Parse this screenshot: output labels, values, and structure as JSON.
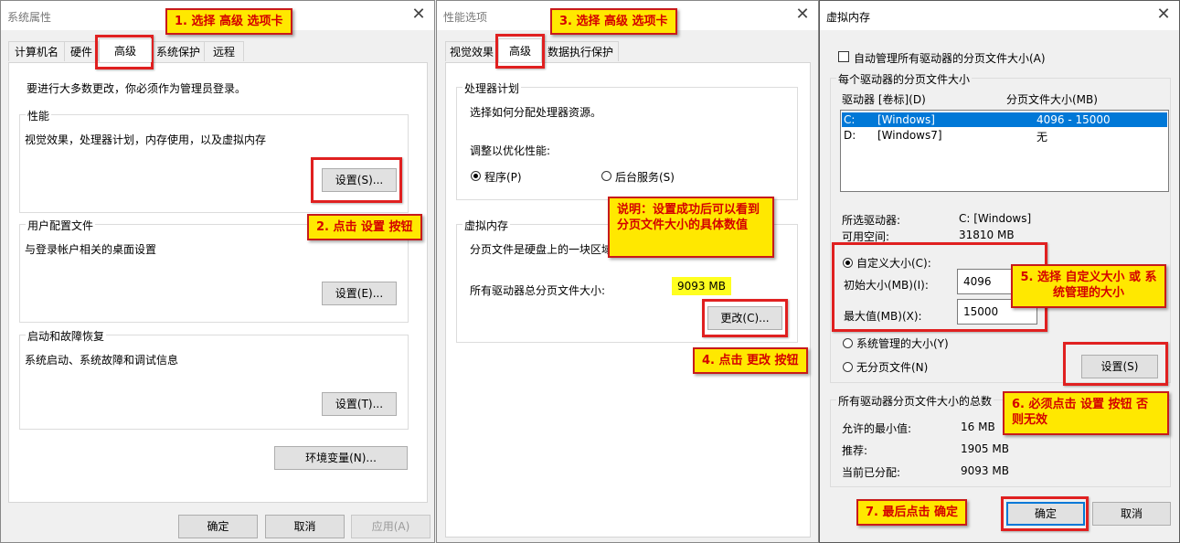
{
  "sys": {
    "title": "系统属性",
    "tabs": [
      "计算机名",
      "硬件",
      "高级",
      "系统保护",
      "远程"
    ],
    "admin_note": "要进行大多数更改，你必须作为管理员登录。",
    "perf_legend": "性能",
    "perf_desc": "视觉效果，处理器计划，内存使用，以及虚拟内存",
    "perf_btn": "设置(S)...",
    "profile_legend": "用户配置文件",
    "profile_desc": "与登录帐户相关的桌面设置",
    "profile_btn": "设置(E)...",
    "startup_legend": "启动和故障恢复",
    "startup_desc": "系统启动、系统故障和调试信息",
    "startup_btn": "设置(T)...",
    "env_btn": "环境变量(N)...",
    "ok": "确定",
    "cancel": "取消",
    "apply": "应用(A)"
  },
  "perf": {
    "title": "性能选项",
    "tabs": [
      "视觉效果",
      "高级",
      "数据执行保护"
    ],
    "sched_legend": "处理器计划",
    "sched_desc": "选择如何分配处理器资源。",
    "adjust": "调整以优化性能:",
    "programs": "程序(P)",
    "services": "后台服务(S)",
    "vm_legend": "虚拟内存",
    "vm_desc": "分页文件是硬盘上的一块区域",
    "total_label": "所有驱动器总分页文件大小:",
    "total_value": "9093 MB",
    "change_btn": "更改(C)..."
  },
  "vm": {
    "title": "虚拟内存",
    "auto_manage": "自动管理所有驱动器的分页文件大小(A)",
    "each_drive_legend": "每个驱动器的分页文件大小",
    "col_drive": "驱动器 [卷标](D)",
    "col_size": "分页文件大小(MB)",
    "drives": [
      {
        "letter": "C:",
        "label": "[Windows]",
        "size": "4096 - 15000"
      },
      {
        "letter": "D:",
        "label": "[Windows7]",
        "size": "无"
      }
    ],
    "selected_label": "所选驱动器:",
    "selected_value": "C:  [Windows]",
    "free_label": "可用空间:",
    "free_value": "31810 MB",
    "custom": "自定义大小(C):",
    "initial_label": "初始大小(MB)(I):",
    "initial_value": "4096",
    "max_label": "最大值(MB)(X):",
    "max_value": "15000",
    "system_managed": "系统管理的大小(Y)",
    "no_paging": "无分页文件(N)",
    "set_btn": "设置(S)",
    "totals_legend": "所有驱动器分页文件大小的总数",
    "min_label": "允许的最小值:",
    "min_value": "16 MB",
    "rec_label": "推荐:",
    "rec_value": "1905 MB",
    "cur_label": "当前已分配:",
    "cur_value": "9093 MB",
    "ok": "确定",
    "cancel": "取消"
  },
  "callouts": {
    "c1": "1. 选择 高级 选项卡",
    "c2": "2. 点击 设置 按钮",
    "c3": "3. 选择 高级 选项卡",
    "note": "说明：设置成功后可以看到分页文件大小的具体数值",
    "c4": "4. 点击 更改 按钮",
    "c5": "5. 选择 自定义大小 或 系统管理的大小",
    "c6": "6. 必须点击 设置 按钮 否则无效",
    "c7": "7. 最后点击 确定"
  },
  "colors": {
    "callout_bg": "#ffe800",
    "callout_text": "#d40000",
    "highlight": "#e02020",
    "selection": "#0078d7"
  }
}
